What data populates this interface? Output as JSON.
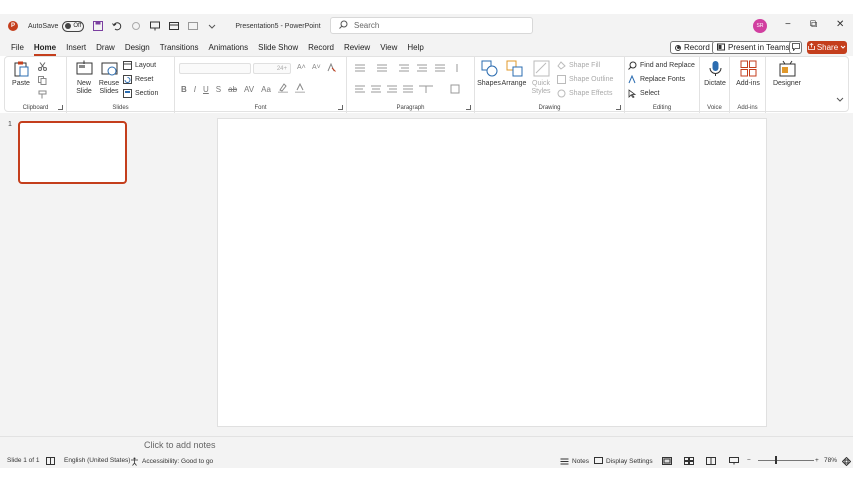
{
  "titlebar": {
    "autosave_label": "AutoSave",
    "autosave_state": "Off",
    "document_title": "Presentation5 - PowerPoint",
    "search_placeholder": "Search",
    "user_initials": "SR",
    "minimize": "−",
    "restore": "⧉",
    "close": "✕"
  },
  "menu": {
    "tabs": [
      "File",
      "Home",
      "Insert",
      "Draw",
      "Design",
      "Transitions",
      "Animations",
      "Slide Show",
      "Record",
      "Review",
      "View",
      "Help"
    ],
    "active_tab": "Home",
    "record_label": "Record",
    "present_label": "Present in Teams",
    "share_label": "Share"
  },
  "ribbon": {
    "clipboard": {
      "paste": "Paste",
      "label": "Clipboard"
    },
    "slides": {
      "new_slide_1": "New",
      "new_slide_2": "Slide",
      "reuse_1": "Reuse",
      "reuse_2": "Slides",
      "layout": "Layout",
      "reset": "Reset",
      "section": "Section",
      "label": "Slides"
    },
    "font": {
      "size": "24+",
      "bold": "B",
      "italic": "I",
      "underline": "U",
      "shadow": "S",
      "strike": "ab",
      "spacing": "AV",
      "case": "Aa",
      "grow": "A˄",
      "shrink": "A˅",
      "label": "Font"
    },
    "paragraph": {
      "label": "Paragraph"
    },
    "drawing": {
      "shapes": "Shapes",
      "arrange": "Arrange",
      "quick_styles_1": "Quick",
      "quick_styles_2": "Styles",
      "shape_fill": "Shape Fill",
      "shape_outline": "Shape Outline",
      "shape_effects": "Shape Effects",
      "label": "Drawing"
    },
    "editing": {
      "find_replace": "Find and Replace",
      "replace_fonts": "Replace Fonts",
      "select": "Select",
      "label": "Editing"
    },
    "voice": {
      "dictate": "Dictate",
      "label": "Voice"
    },
    "addins": {
      "addins": "Add-ins",
      "label": "Add-ins"
    },
    "designer": {
      "designer": "Designer"
    }
  },
  "slides_pane": {
    "slide_number": "1"
  },
  "notes": {
    "placeholder": "Click to add notes"
  },
  "statusbar": {
    "slide_info": "Slide 1 of 1",
    "language": "English (United States)",
    "accessibility": "Accessibility: Good to go",
    "notes": "Notes",
    "display_settings": "Display Settings",
    "zoom_minus": "−",
    "zoom_plus": "+",
    "zoom_level": "78%"
  },
  "colors": {
    "accent": "#c43e1c",
    "background": "#f3f3f3"
  }
}
